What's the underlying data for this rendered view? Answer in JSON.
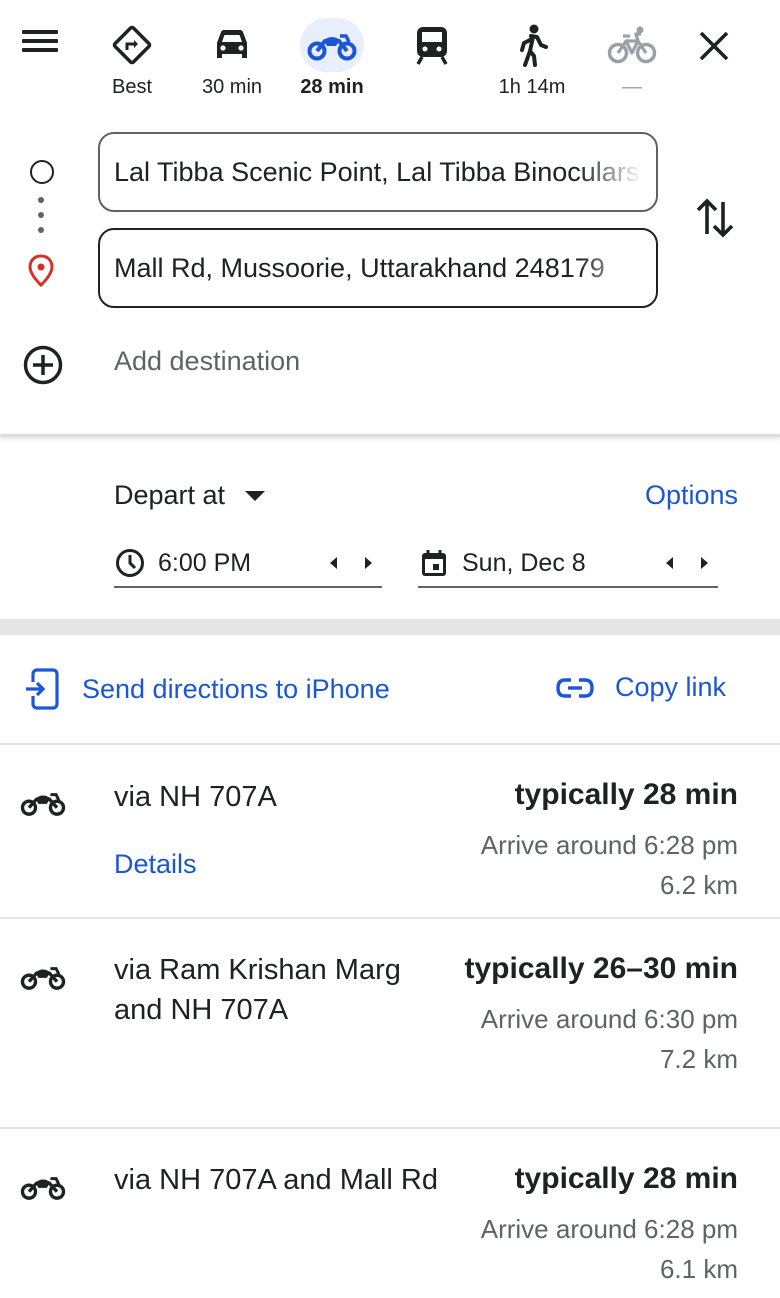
{
  "modes": [
    {
      "icon": "directions-best-icon",
      "label": "Best",
      "active": false,
      "disabled": false
    },
    {
      "icon": "car-icon",
      "label": "30 min",
      "active": false,
      "disabled": false
    },
    {
      "icon": "motorcycle-icon",
      "label": "28 min",
      "active": true,
      "disabled": false
    },
    {
      "icon": "transit-icon",
      "label": "",
      "active": false,
      "disabled": false
    },
    {
      "icon": "walk-icon",
      "label": "1h 14m",
      "active": false,
      "disabled": false
    },
    {
      "icon": "bicycle-icon",
      "label": "—",
      "active": false,
      "disabled": true
    }
  ],
  "origin": {
    "value": "Lal Tibba Scenic Point, Lal Tibba Binoculars"
  },
  "destination": {
    "value": "Mall Rd, Mussoorie, Uttarakhand 248179"
  },
  "add_destination": "Add destination",
  "depart": {
    "label": "Depart at",
    "options": "Options",
    "time": "6:00 PM",
    "date": "Sun, Dec 8"
  },
  "share": {
    "send": "Send directions to iPhone",
    "copy": "Copy link"
  },
  "routes": [
    {
      "name": "via NH 707A",
      "time": "typically 28 min",
      "arrive": "Arrive around 6:28 pm",
      "distance": "6.2 km",
      "details": "Details"
    },
    {
      "name": "via Ram Krishan Marg and NH 707A",
      "time": "typically 26–30 min",
      "arrive": "Arrive around 6:30 pm",
      "distance": "7.2 km"
    },
    {
      "name": "via NH 707A and Mall Rd",
      "time": "typically 28 min",
      "arrive": "Arrive around 6:28 pm",
      "distance": "6.1 km"
    }
  ],
  "colors": {
    "accent": "#1a57d6",
    "active_mode_bg": "#e8eefb",
    "pin": "#d93025",
    "secondary_text": "#5f6368"
  }
}
